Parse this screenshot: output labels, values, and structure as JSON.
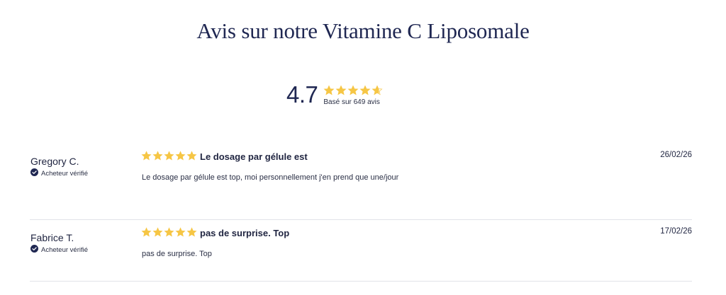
{
  "page": {
    "title": "Avis sur notre Vitamine C Liposomale"
  },
  "summary": {
    "average": "4.7",
    "rating_value": 4.7,
    "rating_max": 5,
    "based_on": "Basé sur 649 avis"
  },
  "colors": {
    "star": "#f6c645",
    "star_empty": "#dcdcdc",
    "text_dark": "#1f2752",
    "divider": "#e1e3e8"
  },
  "reviews": [
    {
      "author": "Gregory C.",
      "verified_label": "Acheteur vérifié",
      "rating": 5,
      "title": "Le dosage par gélule est",
      "date": "26/02/26",
      "body": "Le dosage par gélule est top, moi personnellement j'en prend que une/jour"
    },
    {
      "author": "Fabrice T.",
      "verified_label": "Acheteur vérifié",
      "rating": 5,
      "title": "pas de surprise. Top",
      "date": "17/02/26",
      "body": "pas de surprise. Top"
    }
  ]
}
